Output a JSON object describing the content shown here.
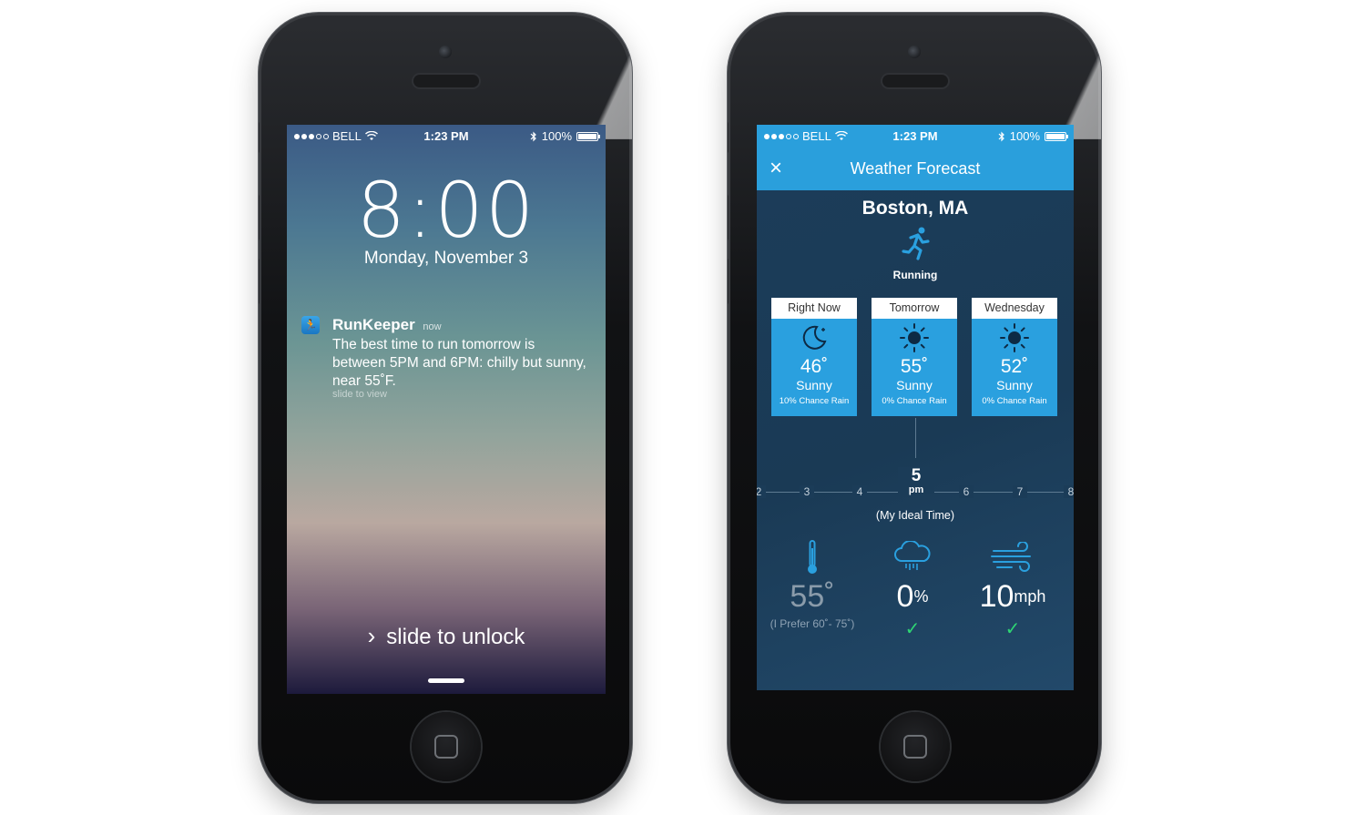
{
  "left_phone": {
    "status": {
      "carrier": "BELL",
      "time": "1:23 PM",
      "battery": "100%"
    },
    "lock": {
      "clock": "8:00",
      "date": "Monday, November 3",
      "notification": {
        "app": "RunKeeper",
        "time": "now",
        "message": "The best time to run tomorrow is between 5PM and 6PM: chilly but sunny, near 55˚F.",
        "hint": "slide to view"
      },
      "unlock_label": "slide to unlock"
    }
  },
  "right_phone": {
    "status": {
      "carrier": "BELL",
      "time": "1:23 PM",
      "battery": "100%"
    },
    "nav": {
      "title": "Weather Forecast",
      "close_glyph": "×"
    },
    "city": "Boston, MA",
    "activity": "Running",
    "forecast": [
      {
        "day": "Right Now",
        "icon": "moon-icon",
        "temp": "46˚",
        "cond": "Sunny",
        "rain": "10% Chance Rain"
      },
      {
        "day": "Tomorrow",
        "icon": "sun-icon",
        "temp": "55˚",
        "cond": "Sunny",
        "rain": "0% Chance Rain"
      },
      {
        "day": "Wednesday",
        "icon": "sun-icon",
        "temp": "52˚",
        "cond": "Sunny",
        "rain": "0% Chance Rain"
      }
    ],
    "timeline": {
      "ticks": [
        "2",
        "3",
        "4",
        "6",
        "7",
        "8"
      ],
      "current_hour": "5",
      "current_ampm": "pm",
      "caption": "(My Ideal Time)"
    },
    "metrics": {
      "temp": {
        "value": "55˚",
        "sub": "(I Prefer 60˚- 75˚)"
      },
      "rain": {
        "value": "0",
        "unit": "%",
        "check": "✓"
      },
      "wind": {
        "value": "10",
        "unit": "mph",
        "check": "✓"
      }
    },
    "colors": {
      "accent": "#2a9fdc",
      "background": "#1a3a55",
      "check": "#2ed573"
    }
  }
}
